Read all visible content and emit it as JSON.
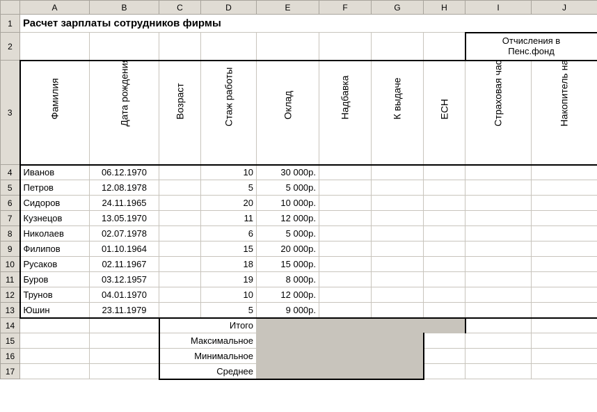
{
  "columns": [
    "A",
    "B",
    "C",
    "D",
    "E",
    "F",
    "G",
    "H",
    "I",
    "J"
  ],
  "rows": [
    "1",
    "2",
    "3",
    "4",
    "5",
    "6",
    "7",
    "8",
    "9",
    "10",
    "11",
    "12",
    "13",
    "14",
    "15",
    "16",
    "17"
  ],
  "title": "Расчет зарплаты сотрудников фирмы",
  "pension_box": {
    "line1": "Отчисления в",
    "line2": "Пенс.фонд"
  },
  "headers": {
    "surname": "Фамилия",
    "dob": "Дата рождения",
    "age": "Возраст",
    "tenure": "Стаж работы",
    "salary": "Оклад",
    "bonus": "Надбавка",
    "topay": "К выдаче",
    "esn": "ЕСН",
    "insur": "Страховая часть",
    "accum": "Накопитель ная часть"
  },
  "data": [
    {
      "surname": "Иванов",
      "dob": "06.12.1970",
      "tenure": "10",
      "salary": "30 000р."
    },
    {
      "surname": "Петров",
      "dob": "12.08.1978",
      "tenure": "5",
      "salary": "5 000р."
    },
    {
      "surname": "Сидоров",
      "dob": "24.11.1965",
      "tenure": "20",
      "salary": "10 000р."
    },
    {
      "surname": "Кузнецов",
      "dob": "13.05.1970",
      "tenure": "11",
      "salary": "12 000р."
    },
    {
      "surname": "Николаев",
      "dob": "02.07.1978",
      "tenure": "6",
      "salary": "5 000р."
    },
    {
      "surname": "Филипов",
      "dob": "01.10.1964",
      "tenure": "15",
      "salary": "20 000р."
    },
    {
      "surname": "Русаков",
      "dob": "02.11.1967",
      "tenure": "18",
      "salary": "15 000р."
    },
    {
      "surname": "Буров",
      "dob": "03.12.1957",
      "tenure": "19",
      "salary": "8 000р."
    },
    {
      "surname": "Трунов",
      "dob": "04.01.1970",
      "tenure": "10",
      "salary": "12 000р."
    },
    {
      "surname": "Юшин",
      "dob": "23.11.1979",
      "tenure": "5",
      "salary": "9 000р."
    }
  ],
  "summary": {
    "total": "Итого",
    "max": "Максимальное",
    "min": "Минимальное",
    "avg": "Среднее"
  },
  "chart_data": {
    "type": "table",
    "title": "Расчет зарплаты сотрудников фирмы",
    "columns": [
      "Фамилия",
      "Дата рождения",
      "Возраст",
      "Стаж работы",
      "Оклад",
      "Надбавка",
      "К выдаче",
      "ЕСН",
      "Страховая часть",
      "Накопительная часть"
    ],
    "rows": [
      [
        "Иванов",
        "06.12.1970",
        null,
        10,
        30000,
        null,
        null,
        null,
        null,
        null
      ],
      [
        "Петров",
        "12.08.1978",
        null,
        5,
        5000,
        null,
        null,
        null,
        null,
        null
      ],
      [
        "Сидоров",
        "24.11.1965",
        null,
        20,
        10000,
        null,
        null,
        null,
        null,
        null
      ],
      [
        "Кузнецов",
        "13.05.1970",
        null,
        11,
        12000,
        null,
        null,
        null,
        null,
        null
      ],
      [
        "Николаев",
        "02.07.1978",
        null,
        6,
        5000,
        null,
        null,
        null,
        null,
        null
      ],
      [
        "Филипов",
        "01.10.1964",
        null,
        15,
        20000,
        null,
        null,
        null,
        null,
        null
      ],
      [
        "Русаков",
        "02.11.1967",
        null,
        18,
        15000,
        null,
        null,
        null,
        null,
        null
      ],
      [
        "Буров",
        "03.12.1957",
        null,
        19,
        8000,
        null,
        null,
        null,
        null,
        null
      ],
      [
        "Трунов",
        "04.01.1970",
        null,
        10,
        12000,
        null,
        null,
        null,
        null,
        null
      ],
      [
        "Юшин",
        "23.11.1979",
        null,
        5,
        9000,
        null,
        null,
        null,
        null,
        null
      ]
    ],
    "currency": "р.",
    "summary_rows": [
      "Итого",
      "Максимальное",
      "Минимальное",
      "Среднее"
    ]
  }
}
